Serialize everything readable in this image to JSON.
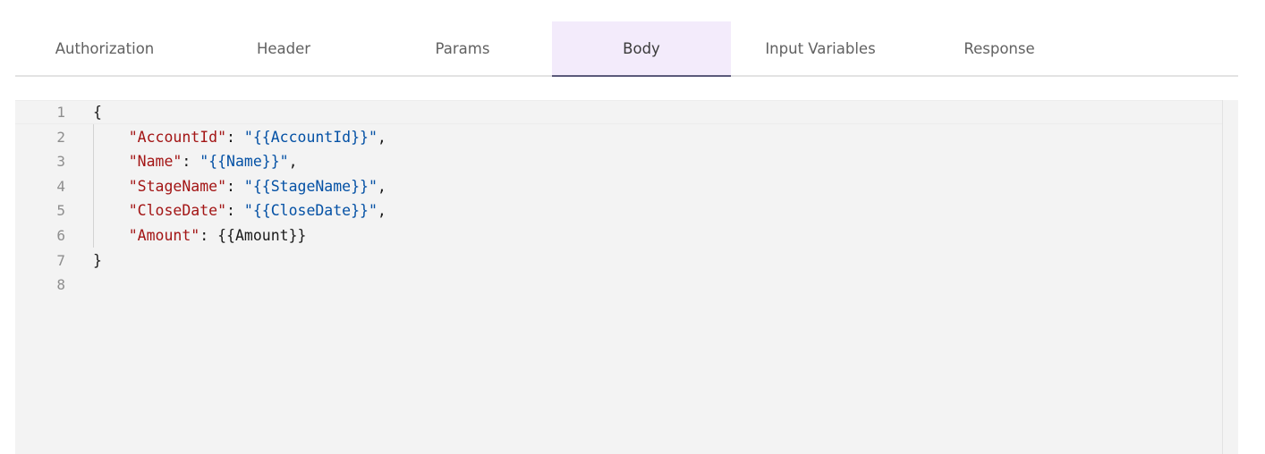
{
  "tabs": [
    {
      "label": "Authorization"
    },
    {
      "label": "Header"
    },
    {
      "label": "Params"
    },
    {
      "label": "Body"
    },
    {
      "label": "Input Variables"
    },
    {
      "label": "Response"
    }
  ],
  "active_tab": "Body",
  "editor": {
    "line_numbers": [
      "1",
      "2",
      "3",
      "4",
      "5",
      "6",
      "7",
      "8"
    ],
    "open_brace": "{",
    "close_brace": "}",
    "rows": [
      {
        "key": "\"AccountId\"",
        "sep": ": ",
        "value": "\"{{AccountId}}\"",
        "trail": ","
      },
      {
        "key": "\"Name\"",
        "sep": ": ",
        "value": "\"{{Name}}\"",
        "trail": ","
      },
      {
        "key": "\"StageName\"",
        "sep": ": ",
        "value": "\"{{StageName}}\"",
        "trail": ","
      },
      {
        "key": "\"CloseDate\"",
        "sep": ": ",
        "value": "\"{{CloseDate}}\"",
        "trail": ","
      },
      {
        "key": "\"Amount\"",
        "sep": ": ",
        "value": "{{Amount}}",
        "trail": ""
      }
    ]
  },
  "colors": {
    "key": "#a31515",
    "string": "#0451a5",
    "active_tab_bg": "#f3ebfb",
    "active_tab_underline": "#5b5a7a",
    "editor_bg": "#f3f3f3"
  }
}
